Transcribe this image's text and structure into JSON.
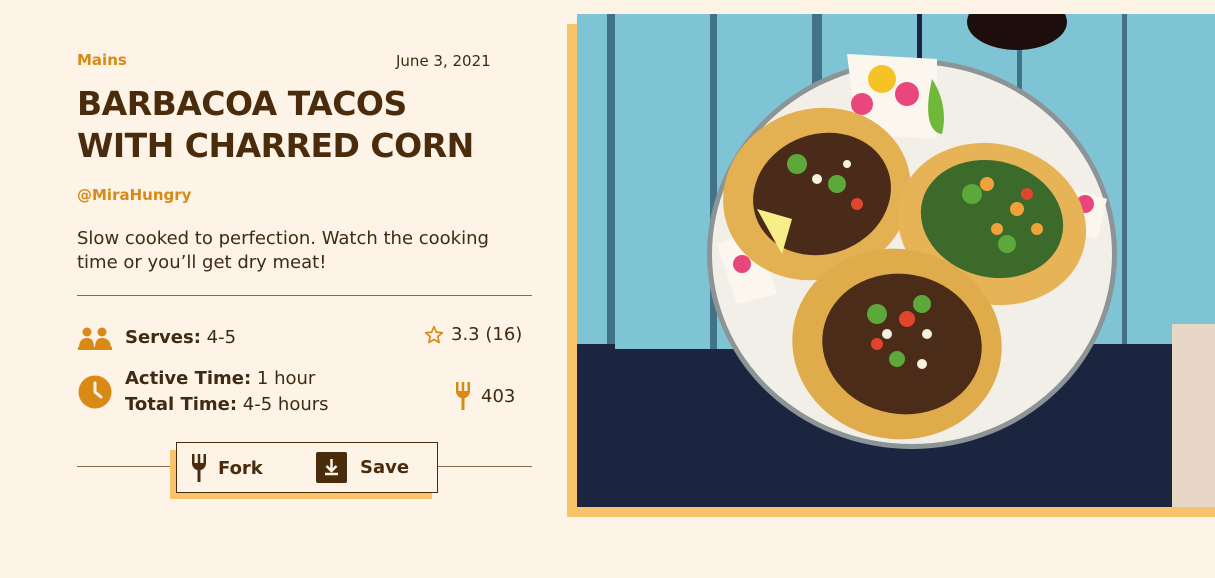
{
  "recipe": {
    "category": "Mains",
    "date": "June 3, 2021",
    "title_line1": "BARBACOA TACOS",
    "title_line2": "WITH CHARRED CORN",
    "author": "@MiraHungry",
    "description": "Slow cooked to perfection. Watch the cooking time or you’ll get dry meat!",
    "serves_label": "Serves:",
    "serves_value": " 4-5",
    "active_label": "Active Time:",
    "active_value": " 1 hour",
    "total_label": "Total Time:",
    "total_value": " 4-5 hours",
    "rating": "3.3 (16)",
    "forks": "403"
  },
  "actions": {
    "fork_label": "Fork",
    "save_label": "Save"
  },
  "icons": {
    "serves": "people-icon",
    "time": "clock-icon",
    "rating": "star-outline-icon",
    "forks_count": "fork-icon",
    "fork_button": "fork-icon",
    "save_button": "download-box-icon"
  },
  "colors": {
    "background": "#fdf3e7",
    "accent": "#d98a16",
    "dark": "#4a2c0c",
    "highlight": "#f9c36a"
  }
}
